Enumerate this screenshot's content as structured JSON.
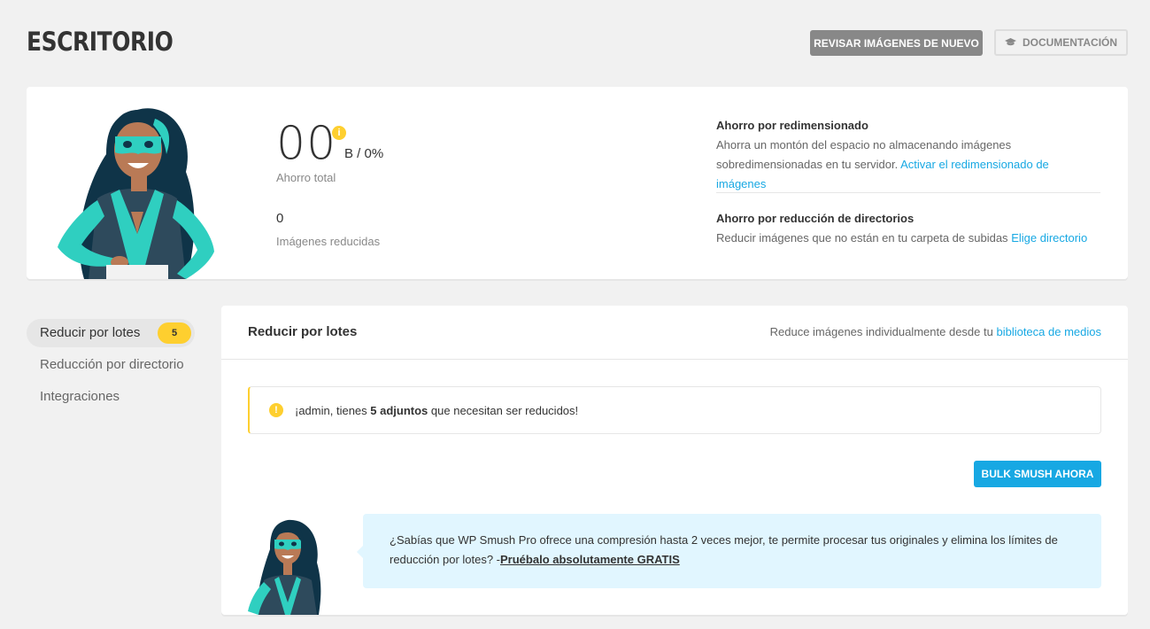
{
  "header": {
    "title": "ESCRITORIO",
    "recheck_label": "REVISAR IMÁGENES DE NUEVO",
    "docs_label": "DOCUMENTACIÓN",
    "docs_icon": "graduation-cap-icon"
  },
  "summary": {
    "total_savings": "00",
    "savings_unit": "B / 0%",
    "total_label": "Ahorro total",
    "images_count": "0",
    "images_label": "Imágenes reducidas",
    "info_icon": "i",
    "resize": {
      "title": "Ahorro por redimensionado",
      "text": "Ahorra un montón del espacio no almacenando imágenes sobredimensionadas en tu servidor.",
      "link": "Activar el redimensionado de imágenes"
    },
    "directory": {
      "title": "Ahorro por reducción de directorios",
      "text": "Reducir imágenes que no están en tu carpeta de subidas",
      "link": "Elige directorio"
    }
  },
  "sidebar": {
    "items": [
      {
        "label": "Reducir por lotes",
        "badge": "5"
      },
      {
        "label": "Reducción por directorio"
      },
      {
        "label": "Integraciones"
      }
    ]
  },
  "bulk": {
    "title": "Reducir por lotes",
    "note": "Reduce imágenes individualmente desde tu",
    "note_link": "biblioteca de medios",
    "notice": {
      "icon": "!",
      "prefix": "¡admin, tienes",
      "bold": "5 adjuntos",
      "suffix": "que necesitan ser reducidos!"
    },
    "button_label": "BULK SMUSH AHORA",
    "promo": {
      "text": "¿Sabías que WP Smush Pro ofrece una compresión hasta 2 veces mejor, te permite procesar tus originales y elimina los límites de reducción por lotes? -",
      "link": "Pruébalo absolutamente GRATIS"
    }
  },
  "colors": {
    "accent": "#17a8e3",
    "warning": "#fecf2f",
    "promo_bg": "#e1f6ff",
    "mascot_teal": "#2fcfc0",
    "mascot_navy": "#0f3448"
  }
}
